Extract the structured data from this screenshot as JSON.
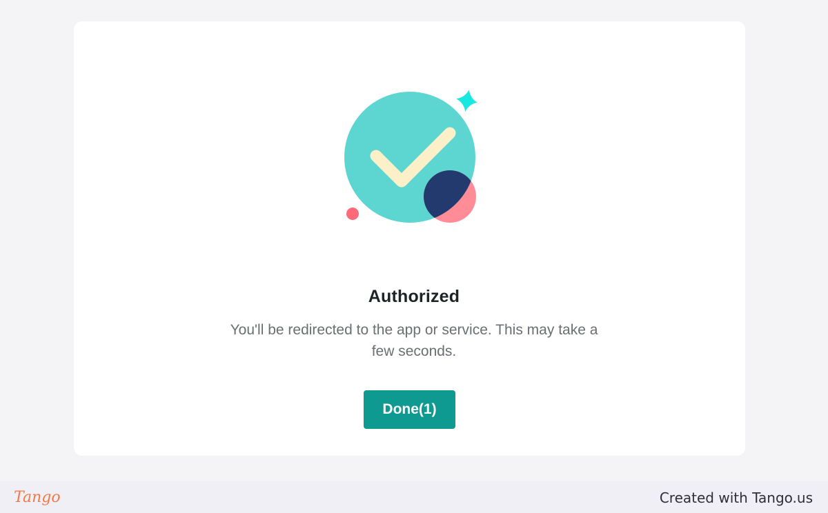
{
  "dialog": {
    "title": "Authorized",
    "message": "You'll be redirected to the app or service. This may take a few seconds.",
    "done_label": "Done(1)"
  },
  "illustration": {
    "icon": "checkmark-badge-icon",
    "colors": {
      "circle": "#5dd6d2",
      "check": "#fbf0c8",
      "dark_circle": "#223a6e",
      "pink_circle": "#ff8c96",
      "sparkle": "#18e8e0",
      "dot": "#ff6a78"
    }
  },
  "footer": {
    "logo_text": "Tango",
    "credit": "Created with Tango.us"
  },
  "colors": {
    "background": "#f4f4f6",
    "card": "#ffffff",
    "accent": "#0f9a91",
    "footer_bg": "#f0eff5",
    "logo": "#f07a4a"
  }
}
